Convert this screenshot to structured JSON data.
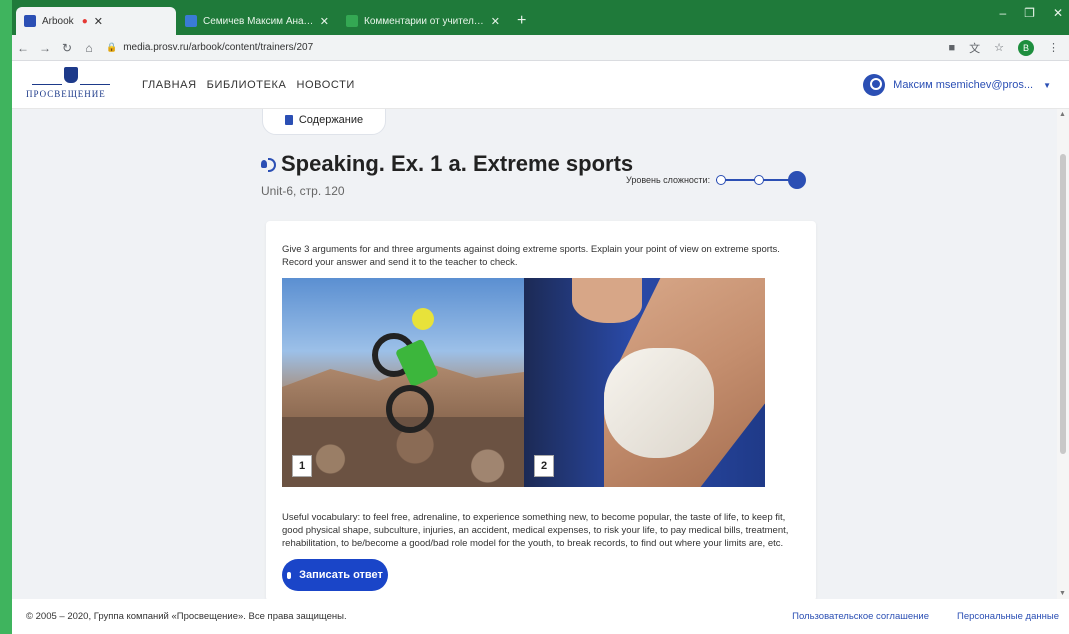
{
  "browser": {
    "tabs": [
      {
        "title": "Arbook",
        "active": true,
        "favicon_color": "#2b4fb4"
      },
      {
        "title": "Семичев Максим Анатольевич",
        "active": false,
        "favicon_color": "#3a7bd5"
      },
      {
        "title": "Комментарии от учителей - Go",
        "active": false,
        "favicon_color": "#34a853"
      }
    ],
    "new_tab": "+",
    "url": "media.prosv.ru/arbook/content/trainers/207",
    "profile_initial": "B"
  },
  "site": {
    "logo_text": "ПРОСВЕЩЕНИЕ",
    "nav": [
      "ГЛАВНАЯ",
      "БИБЛИОТЕКА",
      "НОВОСТИ"
    ],
    "user": "Максим msemichev@pros..."
  },
  "content": {
    "toc_label": "Содержание",
    "title": "Speaking. Ex. 1 a. Extreme sports",
    "subtitle": "Unit-6, стр. 120",
    "level_label": "Уровень сложности:",
    "level": {
      "current": 3,
      "max": 3
    },
    "task": "Give 3 arguments for and three arguments against doing extreme sports. Explain your point of view on extreme sports. Record your answer and send it to the teacher to check.",
    "image_labels": [
      "1",
      "2"
    ],
    "vocab": "Useful vocabulary: to feel free, adrenaline, to experience something new, to become popular, the taste of life, to keep fit, good physical shape, subculture, injuries, an accident, medical expenses, to risk your life, to pay medical bills, treatment, rehabilitation, to be/become a good/bad role model for the youth, to break records, to find out where your limits are, etc.",
    "record_button": "Записать ответ"
  },
  "footer": {
    "copyright": "© 2005 – 2020, Группа компаний «Просвещение». Все права защищены.",
    "links": [
      "Пользовательское соглашение",
      "Персональные данные"
    ]
  },
  "colors": {
    "accent": "#1a45c8",
    "frame": "#1f7a3a"
  }
}
